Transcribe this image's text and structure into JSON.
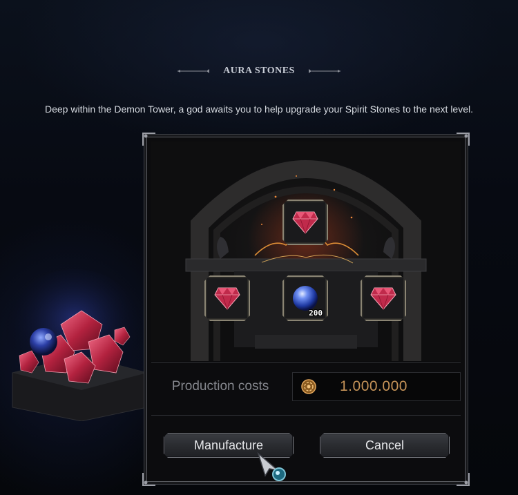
{
  "dialog": {
    "title": "AURA STONES",
    "description": "Deep within the Demon Tower, a god awaits you to help upgrade your Spirit Stones to the next level."
  },
  "slots": {
    "result": {
      "icon": "red-crystal-icon"
    },
    "input_left": {
      "icon": "red-crystal-icon"
    },
    "input_middle": {
      "icon": "blue-orb-icon",
      "count": "200"
    },
    "input_right": {
      "icon": "red-crystal-icon"
    }
  },
  "cost": {
    "label": "Production costs",
    "icon": "gold-coin-icon",
    "value": "1.000.000"
  },
  "buttons": {
    "manufacture": "Manufacture",
    "cancel": "Cancel"
  },
  "colors": {
    "cost_value": "#c59358",
    "accent_fire": "#e0762a",
    "frame": "#8a8473"
  }
}
